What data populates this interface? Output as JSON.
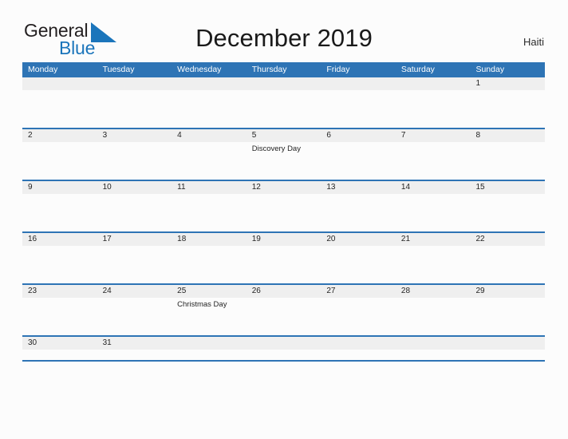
{
  "brand": {
    "name_part1": "General",
    "name_part2": "Blue",
    "flag_icon": "blue-triangle-flag-icon",
    "color_dark": "#231f20",
    "color_blue": "#1b75bb"
  },
  "header": {
    "title": "December 2019",
    "country": "Haiti"
  },
  "calendar": {
    "accent_color": "#2e74b5",
    "band_color": "#efefef",
    "weekdays": [
      "Monday",
      "Tuesday",
      "Wednesday",
      "Thursday",
      "Friday",
      "Saturday",
      "Sunday"
    ],
    "weeks": [
      {
        "days": [
          {
            "num": "",
            "event": ""
          },
          {
            "num": "",
            "event": ""
          },
          {
            "num": "",
            "event": ""
          },
          {
            "num": "",
            "event": ""
          },
          {
            "num": "",
            "event": ""
          },
          {
            "num": "",
            "event": ""
          },
          {
            "num": "1",
            "event": ""
          }
        ]
      },
      {
        "days": [
          {
            "num": "2",
            "event": ""
          },
          {
            "num": "3",
            "event": ""
          },
          {
            "num": "4",
            "event": ""
          },
          {
            "num": "5",
            "event": "Discovery Day"
          },
          {
            "num": "6",
            "event": ""
          },
          {
            "num": "7",
            "event": ""
          },
          {
            "num": "8",
            "event": ""
          }
        ]
      },
      {
        "days": [
          {
            "num": "9",
            "event": ""
          },
          {
            "num": "10",
            "event": ""
          },
          {
            "num": "11",
            "event": ""
          },
          {
            "num": "12",
            "event": ""
          },
          {
            "num": "13",
            "event": ""
          },
          {
            "num": "14",
            "event": ""
          },
          {
            "num": "15",
            "event": ""
          }
        ]
      },
      {
        "days": [
          {
            "num": "16",
            "event": ""
          },
          {
            "num": "17",
            "event": ""
          },
          {
            "num": "18",
            "event": ""
          },
          {
            "num": "19",
            "event": ""
          },
          {
            "num": "20",
            "event": ""
          },
          {
            "num": "21",
            "event": ""
          },
          {
            "num": "22",
            "event": ""
          }
        ]
      },
      {
        "days": [
          {
            "num": "23",
            "event": ""
          },
          {
            "num": "24",
            "event": ""
          },
          {
            "num": "25",
            "event": "Christmas Day"
          },
          {
            "num": "26",
            "event": ""
          },
          {
            "num": "27",
            "event": ""
          },
          {
            "num": "28",
            "event": ""
          },
          {
            "num": "29",
            "event": ""
          }
        ]
      },
      {
        "days": [
          {
            "num": "30",
            "event": ""
          },
          {
            "num": "31",
            "event": ""
          },
          {
            "num": "",
            "event": ""
          },
          {
            "num": "",
            "event": ""
          },
          {
            "num": "",
            "event": ""
          },
          {
            "num": "",
            "event": ""
          },
          {
            "num": "",
            "event": ""
          }
        ]
      }
    ]
  }
}
